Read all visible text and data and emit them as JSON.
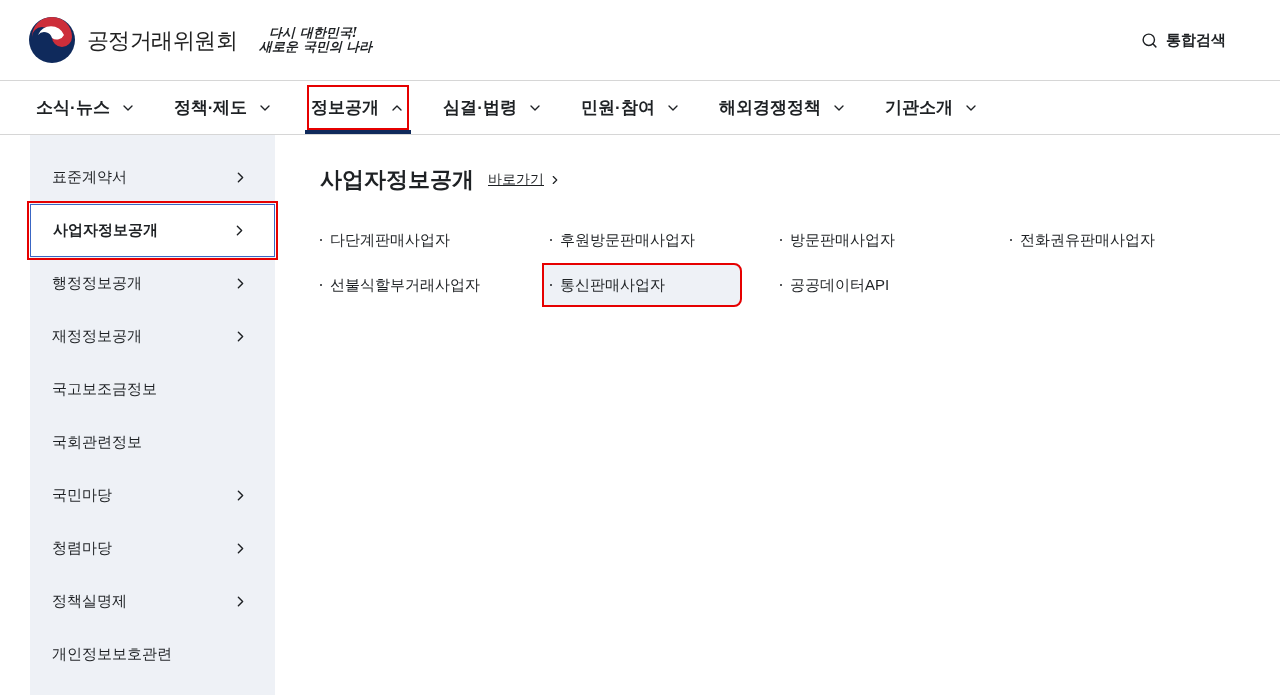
{
  "header": {
    "org_name": "공정거래위원회",
    "slogan": [
      "다시 대한민국!",
      "새로운 국민의 나라"
    ],
    "search": "통합검색"
  },
  "nav": [
    {
      "label": "소식·뉴스",
      "expanded": false,
      "annotated": false
    },
    {
      "label": "정책·제도",
      "expanded": false,
      "annotated": false
    },
    {
      "label": "정보공개",
      "expanded": true,
      "annotated": true
    },
    {
      "label": "심결·법령",
      "expanded": false,
      "annotated": false
    },
    {
      "label": "민원·참여",
      "expanded": false,
      "annotated": false
    },
    {
      "label": "해외경쟁정책",
      "expanded": false,
      "annotated": false
    },
    {
      "label": "기관소개",
      "expanded": false,
      "annotated": false
    }
  ],
  "sidebar": [
    {
      "label": "표준계약서",
      "has_submenu": true,
      "selected": false,
      "annotated": false
    },
    {
      "label": "사업자정보공개",
      "has_submenu": true,
      "selected": true,
      "annotated": true
    },
    {
      "label": "행정정보공개",
      "has_submenu": true,
      "selected": false,
      "annotated": false
    },
    {
      "label": "재정정보공개",
      "has_submenu": true,
      "selected": false,
      "annotated": false
    },
    {
      "label": "국고보조금정보",
      "has_submenu": false,
      "selected": false,
      "annotated": false
    },
    {
      "label": "국회관련정보",
      "has_submenu": false,
      "selected": false,
      "annotated": false
    },
    {
      "label": "국민마당",
      "has_submenu": true,
      "selected": false,
      "annotated": false
    },
    {
      "label": "청렴마당",
      "has_submenu": true,
      "selected": false,
      "annotated": false
    },
    {
      "label": "정책실명제",
      "has_submenu": true,
      "selected": false,
      "annotated": false
    },
    {
      "label": "개인정보보호관련",
      "has_submenu": false,
      "selected": false,
      "annotated": false
    }
  ],
  "content": {
    "title": "사업자정보공개",
    "shortcut": "바로가기",
    "links": [
      {
        "label": "다단계판매사업자",
        "selected": false,
        "annotated": false
      },
      {
        "label": "후원방문판매사업자",
        "selected": false,
        "annotated": false
      },
      {
        "label": "방문판매사업자",
        "selected": false,
        "annotated": false
      },
      {
        "label": "전화권유판매사업자",
        "selected": false,
        "annotated": false
      },
      {
        "label": "선불식할부거래사업자",
        "selected": false,
        "annotated": false
      },
      {
        "label": "통신판매사업자",
        "selected": true,
        "annotated": true
      },
      {
        "label": "공공데이터API",
        "selected": false,
        "annotated": false
      }
    ]
  }
}
